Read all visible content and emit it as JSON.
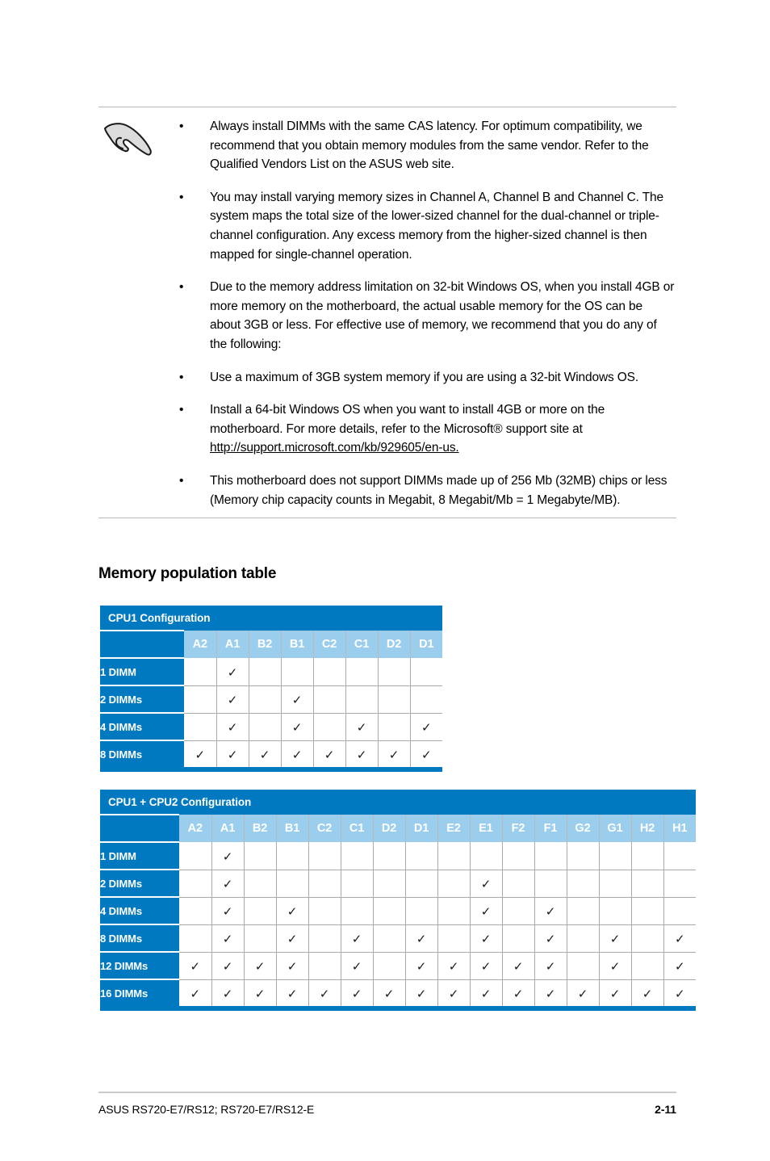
{
  "note": {
    "icon": "note-pointing-hand-icon",
    "bullet_glyph": "•",
    "items": [
      "Always install DIMMs with the same CAS latency. For optimum compatibility, we recommend that you obtain memory modules from the same vendor. Refer to the Qualified Vendors List on the ASUS web site.",
      "You may install varying memory sizes in Channel A, Channel B and Channel C. The system maps the total size of the lower-sized channel for the dual-channel or triple-channel configuration. Any excess memory from the higher-sized channel is then mapped for single-channel operation.",
      "Due to the memory address limitation on 32-bit Windows OS, when you install 4GB or more memory on the motherboard, the actual usable memory for the OS can be about 3GB or less. For effective use of memory, we recommend that you do any of the following:",
      "Use a maximum of 3GB system memory if you are using a 32-bit Windows OS.",
      "Install a 64-bit Windows OS when you want to install 4GB or more on the motherboard. For more details, refer to the Microsoft® support site at ",
      "This motherboard does not support DIMMs made up of 256 Mb (32MB) chips or less (Memory chip capacity counts in Megabit, 8 Megabit/Mb = 1 Megabyte/MB)."
    ],
    "link_text": "http://support.microsoft.com/kb/929605/en-us."
  },
  "section": {
    "heading": "Memory population table"
  },
  "colors": {
    "header_blue": "#0079c1",
    "column_head_blue": "#9bcded",
    "grid_gray": "#a9a9a9",
    "rule_gray": "#b8b8b8"
  },
  "table1": {
    "title": "CPU1 Configuration",
    "columns": [
      "A2",
      "A1",
      "B2",
      "B1",
      "C2",
      "C1",
      "D2",
      "D1"
    ],
    "check_glyph": "✓",
    "rows": [
      {
        "label": "1 DIMM",
        "cells": [
          false,
          true,
          false,
          false,
          false,
          false,
          false,
          false
        ]
      },
      {
        "label": "2 DIMMs",
        "cells": [
          false,
          true,
          false,
          true,
          false,
          false,
          false,
          false
        ]
      },
      {
        "label": "4 DIMMs",
        "cells": [
          false,
          true,
          false,
          true,
          false,
          true,
          false,
          true
        ]
      },
      {
        "label": "8 DIMMs",
        "cells": [
          true,
          true,
          true,
          true,
          true,
          true,
          true,
          true
        ]
      }
    ]
  },
  "table2": {
    "title": "CPU1 + CPU2 Configuration",
    "columns": [
      "A2",
      "A1",
      "B2",
      "B1",
      "C2",
      "C1",
      "D2",
      "D1",
      "E2",
      "E1",
      "F2",
      "F1",
      "G2",
      "G1",
      "H2",
      "H1"
    ],
    "check_glyph": "✓",
    "rows": [
      {
        "label": "1 DIMM",
        "cells": [
          false,
          true,
          false,
          false,
          false,
          false,
          false,
          false,
          false,
          false,
          false,
          false,
          false,
          false,
          false,
          false
        ]
      },
      {
        "label": "2 DIMMs",
        "cells": [
          false,
          true,
          false,
          false,
          false,
          false,
          false,
          false,
          false,
          true,
          false,
          false,
          false,
          false,
          false,
          false
        ]
      },
      {
        "label": "4 DIMMs",
        "cells": [
          false,
          true,
          false,
          true,
          false,
          false,
          false,
          false,
          false,
          true,
          false,
          true,
          false,
          false,
          false,
          false
        ]
      },
      {
        "label": "8 DIMMs",
        "cells": [
          false,
          true,
          false,
          true,
          false,
          true,
          false,
          true,
          false,
          true,
          false,
          true,
          false,
          true,
          false,
          true
        ]
      },
      {
        "label": "12 DIMMs",
        "cells": [
          true,
          true,
          true,
          true,
          false,
          true,
          false,
          true,
          true,
          true,
          true,
          true,
          false,
          true,
          false,
          true
        ]
      },
      {
        "label": "16 DIMMs",
        "cells": [
          true,
          true,
          true,
          true,
          true,
          true,
          true,
          true,
          true,
          true,
          true,
          true,
          true,
          true,
          true,
          true
        ]
      }
    ]
  },
  "footer": {
    "left": "ASUS RS720-E7/RS12; RS720-E7/RS12-E",
    "page": "2-11"
  }
}
